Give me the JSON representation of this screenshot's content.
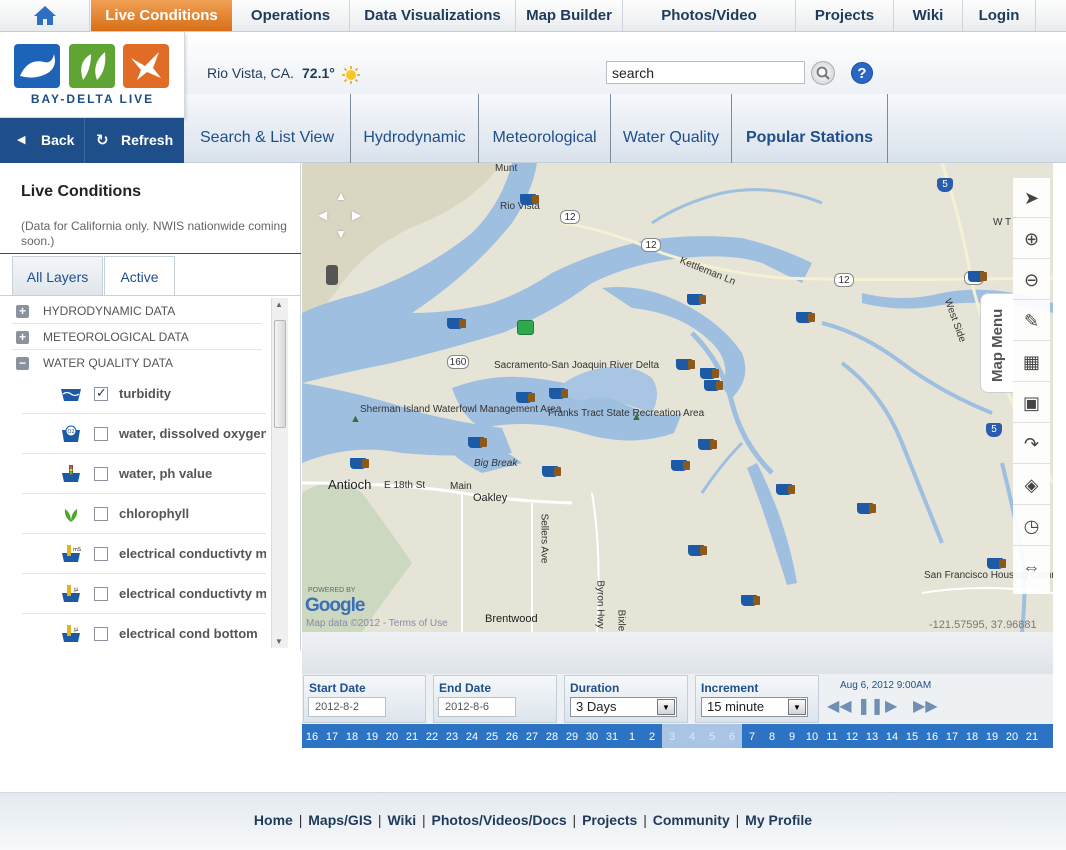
{
  "top_nav": {
    "items": [
      "Live Conditions",
      "Operations",
      "Data Visualizations",
      "Map Builder",
      "Photos/Video",
      "Projects",
      "Wiki",
      "Login"
    ]
  },
  "brand": {
    "logo_text": "BAY-DELTA LIVE"
  },
  "weather": {
    "location": "Rio Vista, CA.",
    "temperature": "72.1°"
  },
  "search": {
    "value": "search"
  },
  "back_bar": {
    "back": "Back",
    "refresh": "Refresh"
  },
  "sub_tabs": [
    "Search & List View",
    "Hydrodynamic",
    "Meteorological",
    "Water Quality",
    "Popular Stations"
  ],
  "left_panel": {
    "title": "Live Conditions",
    "note": "(Data for California only. NWIS nationwide coming soon.)",
    "tabs": [
      "All Layers",
      "Active"
    ],
    "categories": [
      {
        "sign": "+",
        "label": "HYDRODYNAMIC DATA"
      },
      {
        "sign": "+",
        "label": "METEOROLOGICAL DATA"
      },
      {
        "sign": "−",
        "label": "WATER QUALITY DATA"
      }
    ],
    "layers": [
      {
        "label": "turbidity",
        "checked": true
      },
      {
        "label": "water, dissolved oxygen",
        "checked": false
      },
      {
        "label": "water, ph value",
        "checked": false
      },
      {
        "label": "chlorophyll",
        "checked": false
      },
      {
        "label": "electrical conductivty m",
        "checked": false
      },
      {
        "label": "electrical conductivty m",
        "checked": false
      },
      {
        "label": "electrical cond bottom",
        "checked": false
      }
    ]
  },
  "map": {
    "labels": {
      "rio_vista": "Rio Vista",
      "kettleman": "Kettleman Ln",
      "delta": "Sacramento-San Joaquin River Delta",
      "sherman": "Sherman Island Waterfowl Management Area",
      "franks": "Franks Tract State Recreation Area",
      "big_break": "Big Break",
      "antioch": "Antioch",
      "e18th": "E 18th St",
      "main": "Main",
      "oakley": "Oakley",
      "sellers": "Sellers Ave",
      "byron": "Byron Hwy",
      "bixler": "Bixle",
      "brentwood": "Brentwood",
      "sf_comm": "San Francisco Housing Communication",
      "west_side": "West Side",
      "wt": "W T",
      "munt": "Munt",
      "r12a": "12",
      "r12b": "12",
      "r12c": "12",
      "r12d": "12",
      "r12e": "12",
      "r160": "160",
      "r5a": "5",
      "r5b": "5"
    },
    "menu_label": "Map Menu",
    "powered_by": "POWERED BY",
    "google": "Google",
    "map_data": "Map data ©2012 - Terms of Use",
    "coordinates": "-121.57595, 37.96881"
  },
  "time_controls": {
    "start_label": "Start Date",
    "start_value": "2012-8-2",
    "end_label": "End Date",
    "end_value": "2012-8-6",
    "duration_label": "Duration",
    "duration_value": "3 Days",
    "increment_label": "Increment",
    "increment_value": "15 minute",
    "current_time": "Aug 6, 2012 9:00AM",
    "dates": [
      "16",
      "17",
      "18",
      "19",
      "20",
      "21",
      "22",
      "23",
      "24",
      "25",
      "26",
      "27",
      "28",
      "29",
      "30",
      "31",
      "1",
      "2",
      "3",
      "4",
      "5",
      "6",
      "7",
      "8",
      "9",
      "10",
      "11",
      "12",
      "13",
      "14",
      "15",
      "16",
      "17",
      "18",
      "19",
      "20",
      "21"
    ],
    "highlighted_range": [
      "3",
      "4",
      "5",
      "6"
    ]
  },
  "footer": {
    "links": [
      "Home",
      "Maps/GIS",
      "Wiki",
      "Photos/Videos/Docs",
      "Projects",
      "Community",
      "My Profile"
    ]
  },
  "colors": {
    "accent_orange": "#e07e26",
    "nav_blue": "#1f4f8a",
    "water": "#9fbfe0",
    "station_brown": "#8b5a1a"
  }
}
